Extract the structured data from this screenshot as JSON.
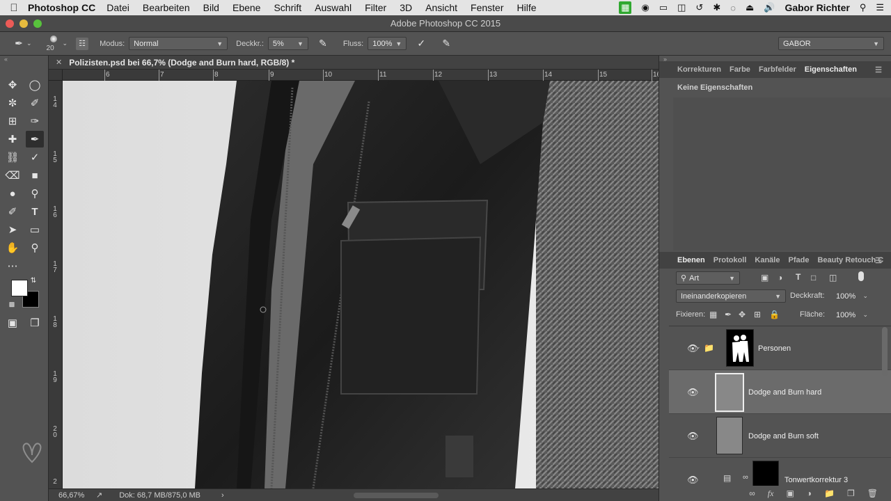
{
  "menubar": {
    "app": "Photoshop CC",
    "items": [
      "Datei",
      "Bearbeiten",
      "Bild",
      "Ebene",
      "Schrift",
      "Auswahl",
      "Filter",
      "3D",
      "Ansicht",
      "Fenster",
      "Hilfe"
    ],
    "user": "Gabor Richter"
  },
  "window": {
    "title": "Adobe Photoshop CC 2015"
  },
  "options": {
    "brush_size": "20",
    "mode_label": "Modus:",
    "mode_value": "Normal",
    "opacity_label": "Deckkr.:",
    "opacity_value": "5%",
    "flow_label": "Fluss:",
    "flow_value": "100%",
    "workspace": "GABOR"
  },
  "document": {
    "tab_title": "Polizisten.psd bei 66,7% (Dodge and Burn hard, RGB/8) *",
    "ruler_h": [
      "6",
      "7",
      "8",
      "9",
      "10",
      "11",
      "12",
      "13",
      "14",
      "15",
      "16"
    ],
    "ruler_v": [
      "1 4",
      "1 5",
      "1 6",
      "1 7",
      "1 8",
      "1 9",
      "2 0",
      "2"
    ],
    "zoom": "66,67%",
    "doc_info": "Dok: 68,7 MB/875,0 MB"
  },
  "properties_panel": {
    "tabs": [
      "Korrekturen",
      "Farbe",
      "Farbfelder",
      "Eigenschaften"
    ],
    "active_tab": "Eigenschaften",
    "content": "Keine Eigenschaften"
  },
  "layers_panel": {
    "tabs": [
      "Ebenen",
      "Protokoll",
      "Kanäle",
      "Pfade",
      "Beauty Retouch C"
    ],
    "active_tab": "Ebenen",
    "filter_value": "Art",
    "blend_mode": "Ineinanderkopieren",
    "opacity_label": "Deckkraft:",
    "opacity_value": "100%",
    "lock_label": "Fixieren:",
    "fill_label": "Fläche:",
    "fill_value": "100%",
    "layers": [
      {
        "name": "Personen",
        "type": "group",
        "visible": true,
        "selected": false
      },
      {
        "name": "Dodge and Burn hard",
        "type": "pixel",
        "visible": true,
        "selected": true
      },
      {
        "name": "Dodge and Burn soft",
        "type": "pixel",
        "visible": true,
        "selected": false
      },
      {
        "name": "Tonwertkorrektur 3",
        "type": "adjustment",
        "visible": true,
        "selected": false
      }
    ]
  },
  "colors": {
    "foreground": "#ffffff",
    "background": "#000000",
    "ui_panel": "#535353",
    "selected_layer": "#6b6b6b"
  },
  "icons": {
    "tools": [
      "move-icon",
      "marquee-icon",
      "lasso-icon",
      "quick-select-icon",
      "crop-icon",
      "eyedropper-icon",
      "healing-icon",
      "brush-icon",
      "stamp-icon",
      "history-brush-icon",
      "eraser-icon",
      "gradient-icon",
      "blur-icon",
      "dodge-icon",
      "pen-icon",
      "type-icon",
      "path-select-icon",
      "shape-icon",
      "hand-icon",
      "zoom-icon",
      "more-tools-icon"
    ]
  }
}
